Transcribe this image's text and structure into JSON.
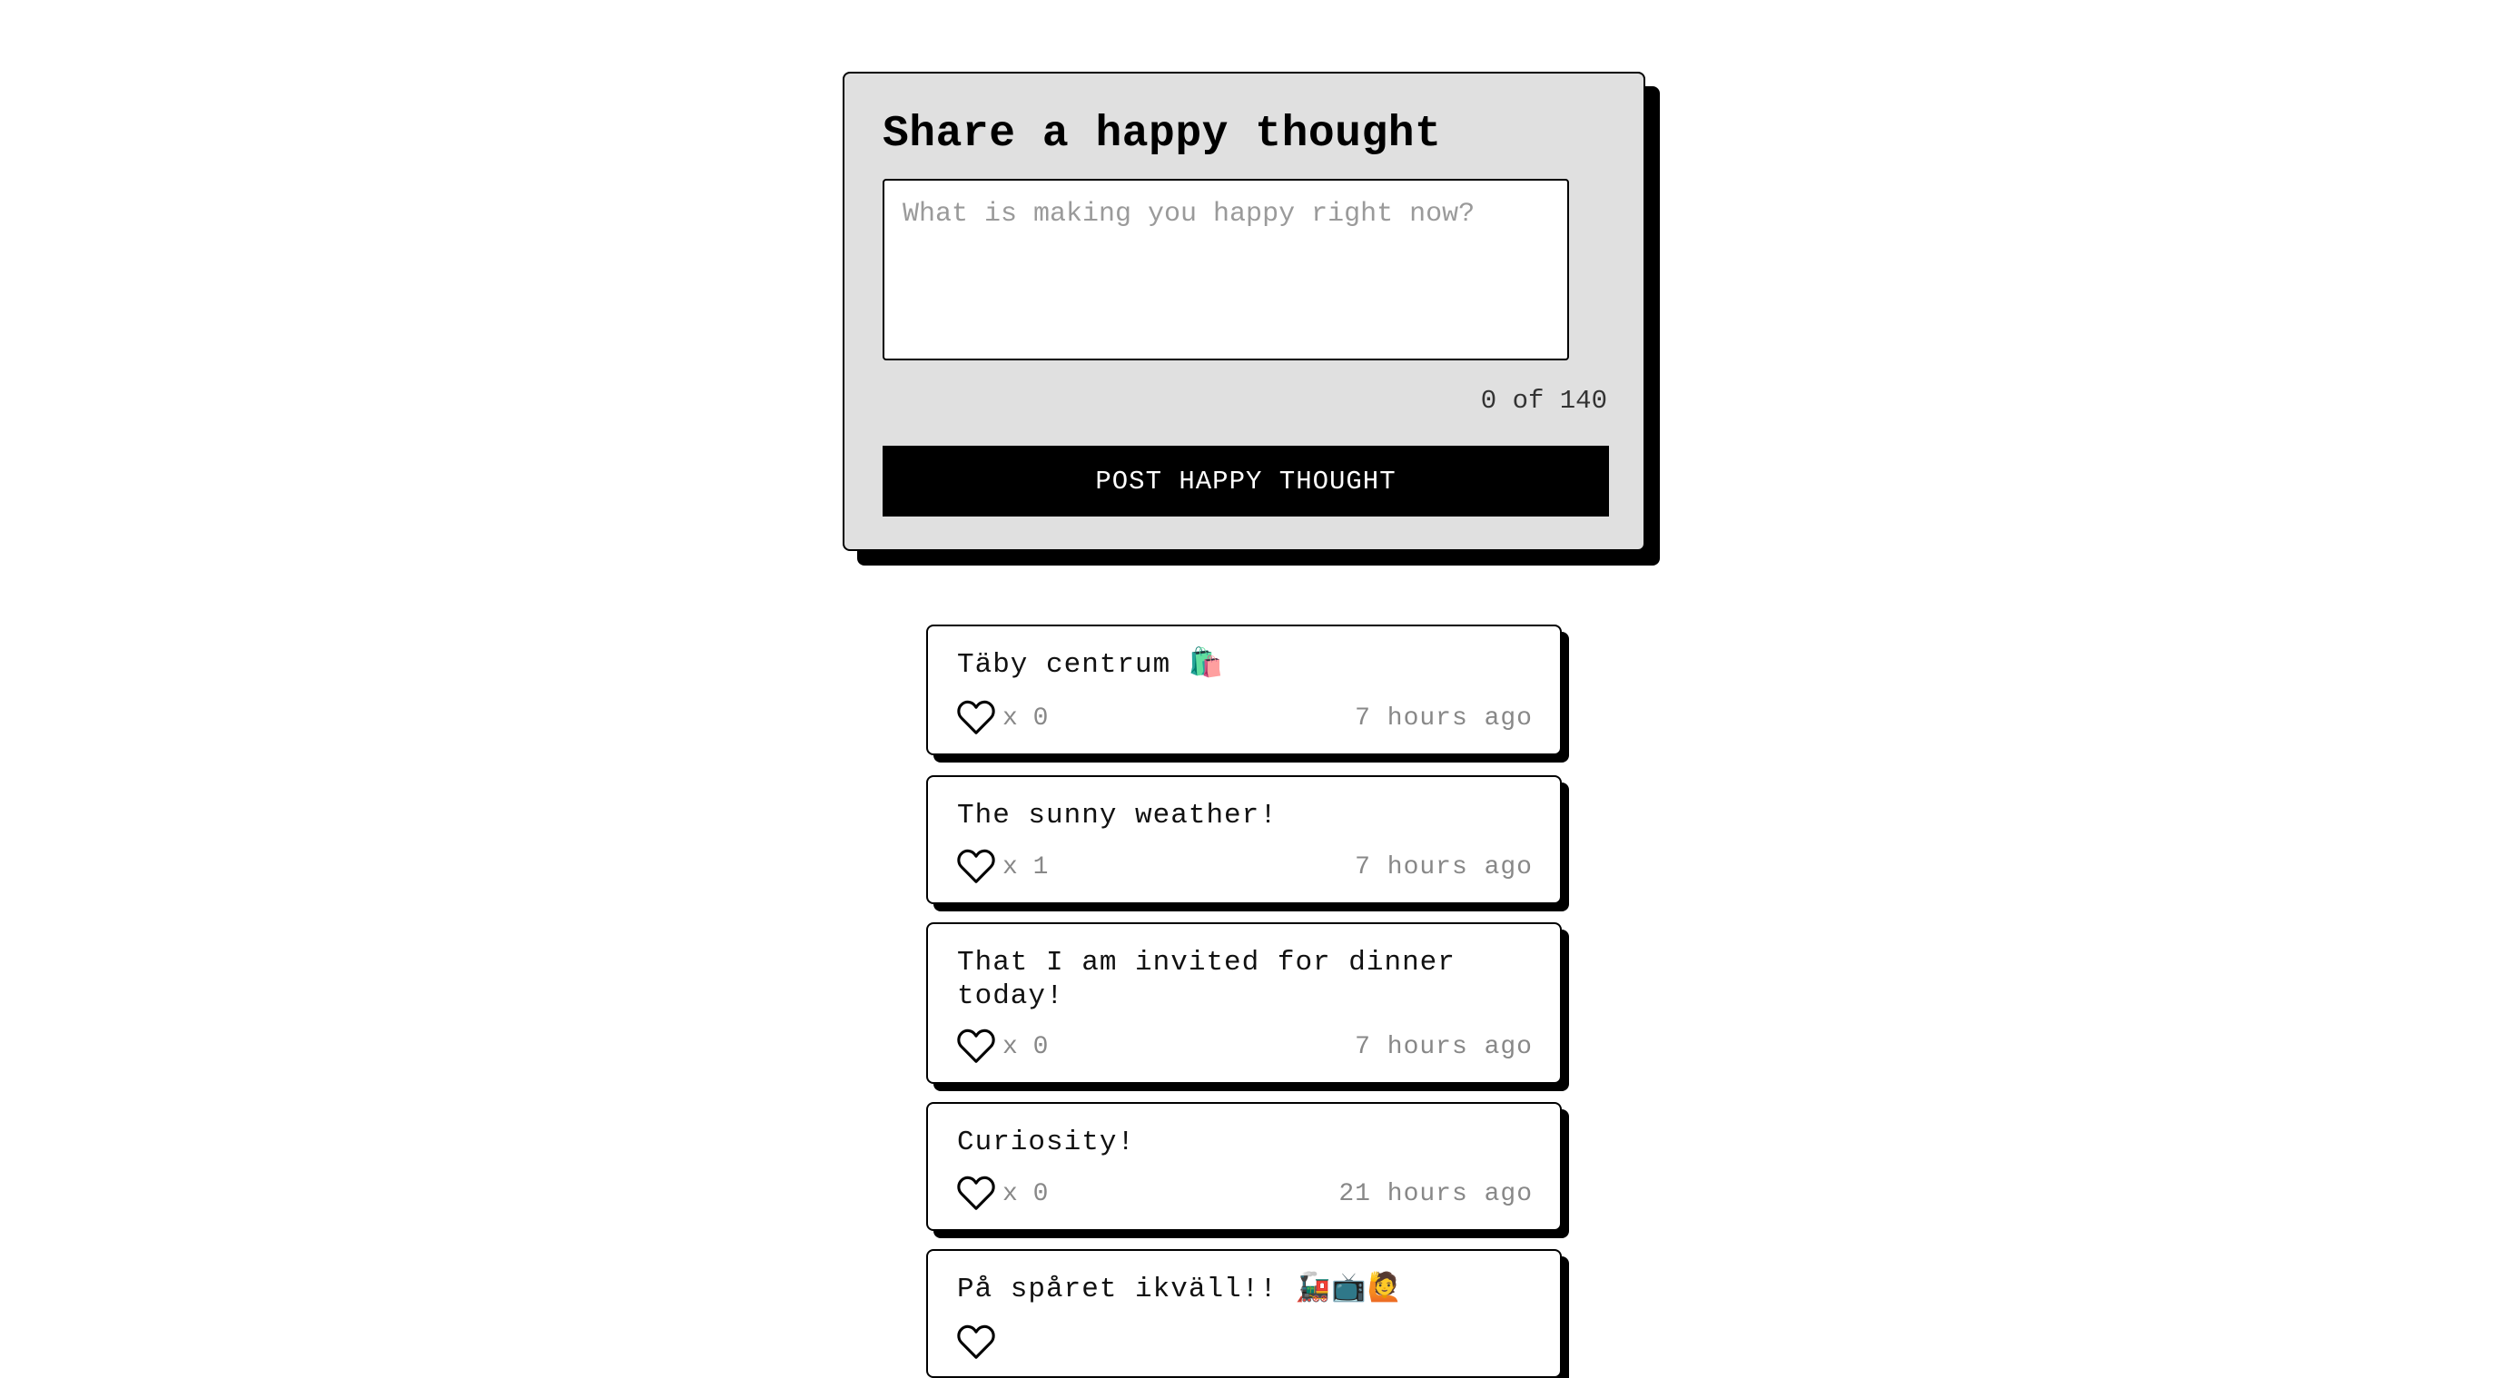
{
  "form": {
    "title": "Share a happy thought",
    "placeholder": "What is making you happy right now?",
    "value": "",
    "counter": "0 of 140",
    "submit_label": "POST HAPPY THOUGHT"
  },
  "thoughts": [
    {
      "text": "Täby centrum 🛍️",
      "likes": "x 0",
      "time": "7 hours ago"
    },
    {
      "text": "The sunny weather!",
      "likes": "x 1",
      "time": "7 hours ago"
    },
    {
      "text": "That I am invited for dinner\ntoday!",
      "likes": "x 0",
      "time": "7 hours ago"
    },
    {
      "text": "Curiosity!",
      "likes": "x 0",
      "time": "21 hours ago"
    },
    {
      "text": "På spåret ikväll!! 🚂📺🙋",
      "likes": "",
      "time": ""
    }
  ],
  "icons": {
    "like": "heart-outline-icon"
  }
}
